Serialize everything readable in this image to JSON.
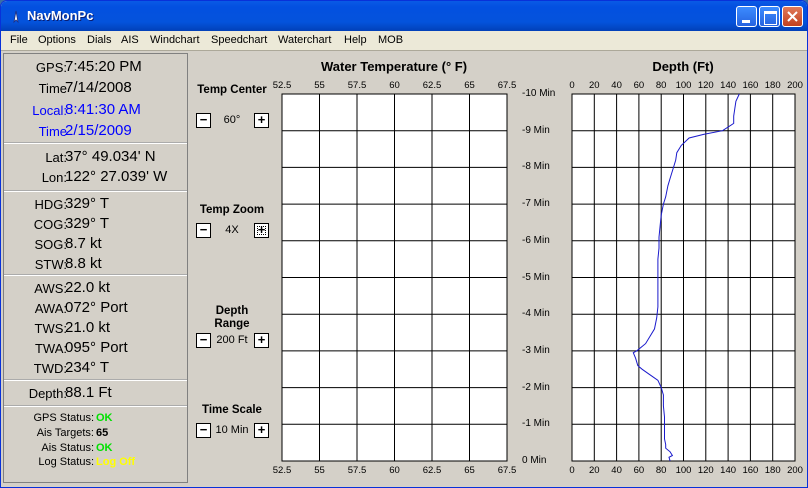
{
  "window": {
    "title": "NavMonPc"
  },
  "menu": [
    "File",
    "Options",
    "Dials",
    "AIS",
    "Windchart",
    "Speedchart",
    "Waterchart",
    "Help",
    "MOB"
  ],
  "status": {
    "time": [
      {
        "label": "GPS:",
        "value": "7:45:20 PM"
      },
      {
        "label": "Time",
        "value": "7/14/2008"
      },
      {
        "label": "Local:",
        "value": "8:41:30 AM"
      },
      {
        "label": "Time",
        "value": "2/15/2009"
      }
    ],
    "position": [
      {
        "label": "Lat:",
        "value": "37° 49.034' N"
      },
      {
        "label": "Lon:",
        "value": "122° 27.039' W"
      }
    ],
    "motion": [
      {
        "label": "HDG:",
        "value": "329° T"
      },
      {
        "label": "COG:",
        "value": "329° T"
      },
      {
        "label": "SOG:",
        "value": "8.7 kt"
      },
      {
        "label": "STW:",
        "value": "8.8 kt"
      }
    ],
    "wind": [
      {
        "label": "AWS:",
        "value": "22.0 kt"
      },
      {
        "label": "AWA:",
        "value": "072° Port"
      },
      {
        "label": "TWS:",
        "value": "21.0 kt"
      },
      {
        "label": "TWA:",
        "value": "095° Port"
      },
      {
        "label": "TWD:",
        "value": "234° T"
      }
    ],
    "depth": {
      "label": "Depth:",
      "value": "88.1 Ft"
    },
    "system": [
      {
        "label": "GPS Status:",
        "value": "OK",
        "color": "#00e000"
      },
      {
        "label": "Ais Targets:",
        "value": "65",
        "color": "#000000"
      },
      {
        "label": "Ais Status:",
        "value": "OK",
        "color": "#00e000"
      },
      {
        "label": "Log Status:",
        "value": "Log Off",
        "color": "#ffff00"
      }
    ]
  },
  "controls": {
    "temp_center": {
      "label": "Temp Center",
      "value": "60°",
      "minus": "−",
      "plus": "+"
    },
    "temp_zoom": {
      "label": "Temp Zoom",
      "value": "4X",
      "minus": "−",
      "plus": "+"
    },
    "depth_range": {
      "label": "Depth Range",
      "value": "200 Ft",
      "minus": "−",
      "plus": "+"
    },
    "time_scale": {
      "label": "Time Scale",
      "value": "10 Min",
      "minus": "−",
      "plus": "+"
    }
  },
  "colors": {
    "trace": "#1a1acc",
    "grid": "#000000",
    "plot_bg": "#ffffff"
  },
  "chart_data": [
    {
      "type": "line",
      "title": "Water Temperature (° F)",
      "x_ticks": [
        "52.5",
        "55",
        "57.5",
        "60",
        "62.5",
        "65",
        "67.5"
      ],
      "xlim": [
        52.5,
        67.5
      ],
      "y_ticks": [
        "-10 Min",
        "-9 Min",
        "-8 Min",
        "-7 Min",
        "-6 Min",
        "-5 Min",
        "-4 Min",
        "-3 Min",
        "-2 Min",
        "-1 Min",
        "0 Min"
      ],
      "ylim": [
        -10,
        0
      ],
      "grid": true,
      "series": []
    },
    {
      "type": "line",
      "title": "Depth (Ft)",
      "x_ticks": [
        "0",
        "20",
        "40",
        "60",
        "80",
        "100",
        "120",
        "140",
        "160",
        "180",
        "200"
      ],
      "xlim": [
        0,
        200
      ],
      "ylim": [
        -10,
        0
      ],
      "grid": true,
      "series": [
        {
          "x": [
            150,
            147,
            146,
            145,
            145,
            135,
            118,
            105,
            98,
            94,
            93,
            91,
            88,
            86,
            84,
            82,
            80,
            79,
            78,
            78,
            77,
            77,
            77,
            77,
            77,
            76,
            74,
            66,
            58,
            55,
            57,
            59,
            63,
            70,
            77,
            80,
            82,
            82,
            83,
            83,
            83,
            83,
            84,
            84,
            88,
            90,
            87,
            88
          ],
          "y": [
            -10,
            -9.8,
            -9.6,
            -9.4,
            -9.2,
            -9.0,
            -8.9,
            -8.8,
            -8.6,
            -8.4,
            -8.2,
            -8.0,
            -7.7,
            -7.5,
            -7.2,
            -7.0,
            -6.7,
            -6.4,
            -6.1,
            -5.8,
            -5.5,
            -5.2,
            -4.9,
            -4.6,
            -4.2,
            -3.9,
            -3.6,
            -3.2,
            -3.0,
            -2.95,
            -2.8,
            -2.6,
            -2.5,
            -2.35,
            -2.2,
            -2.0,
            -1.8,
            -1.5,
            -1.2,
            -1.0,
            -0.8,
            -0.6,
            -0.45,
            -0.35,
            -0.25,
            -0.15,
            -0.1,
            0
          ]
        }
      ]
    }
  ]
}
